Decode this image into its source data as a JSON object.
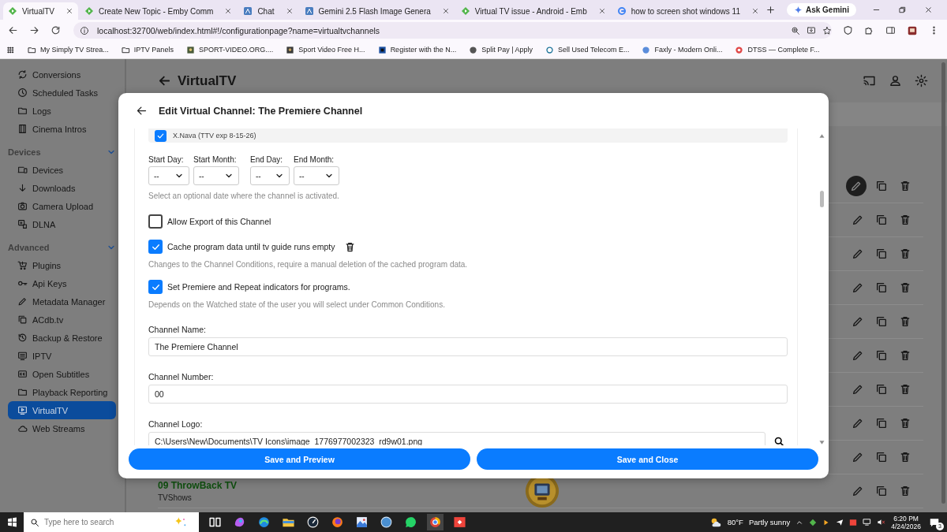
{
  "browser": {
    "tabs": [
      {
        "title": "VirtualTV",
        "selected": true
      },
      {
        "title": "Create New Topic - Emby Comm",
        "selected": false
      },
      {
        "title": "Chat",
        "selected": false
      },
      {
        "title": "Gemini 2.5 Flash Image Genera",
        "selected": false
      },
      {
        "title": "Virtual TV issue - Android - Emb",
        "selected": false
      },
      {
        "title": "how to screen shot windows 11",
        "selected": false
      }
    ],
    "ask_button": "Ask Gemini",
    "address": "localhost:32700/web/index.html#!/configurationpage?name=virtualtvchannels",
    "bookmarks": [
      "My Simply TV Strea...",
      "IPTV Panels",
      "SPORT-VIDEO.ORG....",
      "Sport Video Free H...",
      "Register with the N...",
      "Split Pay | Apply",
      "Sell Used Telecom E...",
      "Faxly - Modern Onli...",
      "DTSS — Complete F..."
    ]
  },
  "sidebar": {
    "items": [
      {
        "kind": "item",
        "label": "Conversions",
        "selected": false
      },
      {
        "kind": "item",
        "label": "Scheduled Tasks",
        "selected": false
      },
      {
        "kind": "item",
        "label": "Logs",
        "selected": false
      },
      {
        "kind": "item",
        "label": "Cinema Intros",
        "selected": false
      },
      {
        "kind": "header",
        "label": "Devices",
        "expanded": true
      },
      {
        "kind": "item",
        "label": "Devices",
        "selected": false
      },
      {
        "kind": "item",
        "label": "Downloads",
        "selected": false
      },
      {
        "kind": "item",
        "label": "Camera Upload",
        "selected": false
      },
      {
        "kind": "item",
        "label": "DLNA",
        "selected": false
      },
      {
        "kind": "header",
        "label": "Advanced",
        "expanded": true
      },
      {
        "kind": "item",
        "label": "Plugins",
        "selected": false
      },
      {
        "kind": "item",
        "label": "Api Keys",
        "selected": false
      },
      {
        "kind": "item",
        "label": "Metadata Manager",
        "selected": false
      },
      {
        "kind": "item",
        "label": "ACdb.tv",
        "selected": false
      },
      {
        "kind": "item",
        "label": "Backup & Restore",
        "selected": false
      },
      {
        "kind": "item",
        "label": "IPTV",
        "selected": false
      },
      {
        "kind": "item",
        "label": "Open Subtitles",
        "selected": false
      },
      {
        "kind": "item",
        "label": "Playback Reporting",
        "selected": false
      },
      {
        "kind": "item",
        "label": "VirtualTV",
        "selected": true
      },
      {
        "kind": "item",
        "label": "Web Streams",
        "selected": false
      }
    ]
  },
  "page": {
    "title": "VirtualTV",
    "rows": [
      {
        "hovered": true
      },
      {
        "hovered": false
      },
      {
        "hovered": false
      },
      {
        "hovered": false
      },
      {
        "hovered": false
      },
      {
        "hovered": false
      },
      {
        "hovered": false
      },
      {
        "hovered": false
      },
      {
        "hovered": false
      },
      {
        "hovered": false,
        "title": "09 ThrowBack TV",
        "subtitle": "TVShows"
      }
    ]
  },
  "modal": {
    "title": "Edit Virtual Channel: The Premiere Channel",
    "user_item": {
      "label": "X.Nava (TTV exp 8-15-26)",
      "checked": true
    },
    "date_fields": [
      {
        "label": "Start Day:",
        "value": "--"
      },
      {
        "label": "Start Month:",
        "value": "--"
      },
      {
        "label": "End Day:",
        "value": "--"
      },
      {
        "label": "End Month:",
        "value": "--"
      }
    ],
    "date_hint": "Select an optional date where the channel is activated.",
    "options": [
      {
        "label": "Allow Export of this Channel",
        "checked": false
      },
      {
        "label": "Cache program data until tv guide runs empty",
        "checked": true,
        "delete_action": true,
        "hint": "Changes to the Channel Conditions, require a manual deletion of the cached program data."
      },
      {
        "label": "Set Premiere and Repeat indicators for programs.",
        "checked": true,
        "hint": "Depends on the Watched state of the user you will select under Common Conditions."
      }
    ],
    "fields": [
      {
        "label": "Channel Name:",
        "value": "The Premiere Channel",
        "browse": false
      },
      {
        "label": "Channel Number:",
        "value": "00",
        "browse": false
      },
      {
        "label": "Channel Logo:",
        "value": "C:\\Users\\New\\Documents\\TV Icons\\image_1776977002323_rd9w01.png",
        "browse": true
      }
    ],
    "buttons": [
      "Save and Preview",
      "Save and Close"
    ]
  },
  "taskbar": {
    "search_placeholder": "Type here to search",
    "temperature": "80°F",
    "weather": "Partly sunny",
    "time": "6:20 PM",
    "date": "4/24/2026",
    "notifications": "3"
  }
}
